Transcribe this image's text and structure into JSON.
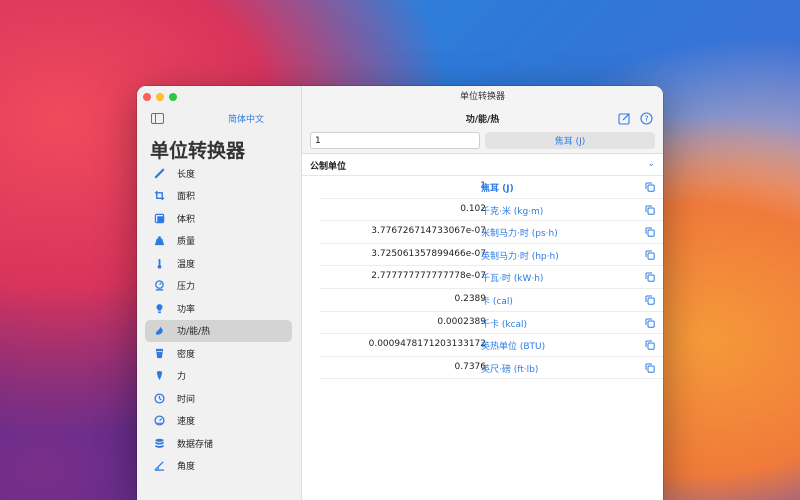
{
  "window": {
    "title": "单位转换器"
  },
  "sidebar": {
    "language_button": "简体中文",
    "app_title": "单位转换器",
    "items": [
      {
        "label": "长度",
        "icon": "ruler-icon"
      },
      {
        "label": "面积",
        "icon": "crop-icon"
      },
      {
        "label": "体积",
        "icon": "cube-icon"
      },
      {
        "label": "质量",
        "icon": "scale-icon"
      },
      {
        "label": "温度",
        "icon": "thermometer-icon"
      },
      {
        "label": "压力",
        "icon": "gauge-icon"
      },
      {
        "label": "功率",
        "icon": "bulb-icon"
      },
      {
        "label": "功/能/热",
        "icon": "flame-icon",
        "active": true
      },
      {
        "label": "密度",
        "icon": "density-icon"
      },
      {
        "label": "力",
        "icon": "force-icon"
      },
      {
        "label": "时间",
        "icon": "clock-icon"
      },
      {
        "label": "速度",
        "icon": "speedometer-icon"
      },
      {
        "label": "数据存储",
        "icon": "database-icon"
      },
      {
        "label": "角度",
        "icon": "angle-icon"
      }
    ]
  },
  "toolbar": {
    "title": "功/能/热"
  },
  "input": {
    "value": "1",
    "selected_unit": "焦耳 (J)"
  },
  "section": {
    "title": "公制单位"
  },
  "results": [
    {
      "value": "1",
      "unit": "焦耳 (J)"
    },
    {
      "value": "0.102",
      "unit": "千克·米 (kg·m)"
    },
    {
      "value": "3.776726714733067e-07",
      "unit": "米制马力·时 (ps·h)"
    },
    {
      "value": "3.725061357899466e-07",
      "unit": "英制马力·时 (hp·h)"
    },
    {
      "value": "2.777777777777778e-07",
      "unit": "千瓦·时 (kW·h)"
    },
    {
      "value": "0.2389",
      "unit": "卡 (cal)"
    },
    {
      "value": "0.0002389",
      "unit": "千卡 (kcal)"
    },
    {
      "value": "0.0009478171203133172",
      "unit": "英热单位 (BTU)"
    },
    {
      "value": "0.7376",
      "unit": "英尺·磅 (ft·lb)"
    }
  ],
  "colors": {
    "accent": "#2c7be5",
    "sidebar_bg": "#f2f1f1",
    "active_item": "#d4d4d4"
  }
}
